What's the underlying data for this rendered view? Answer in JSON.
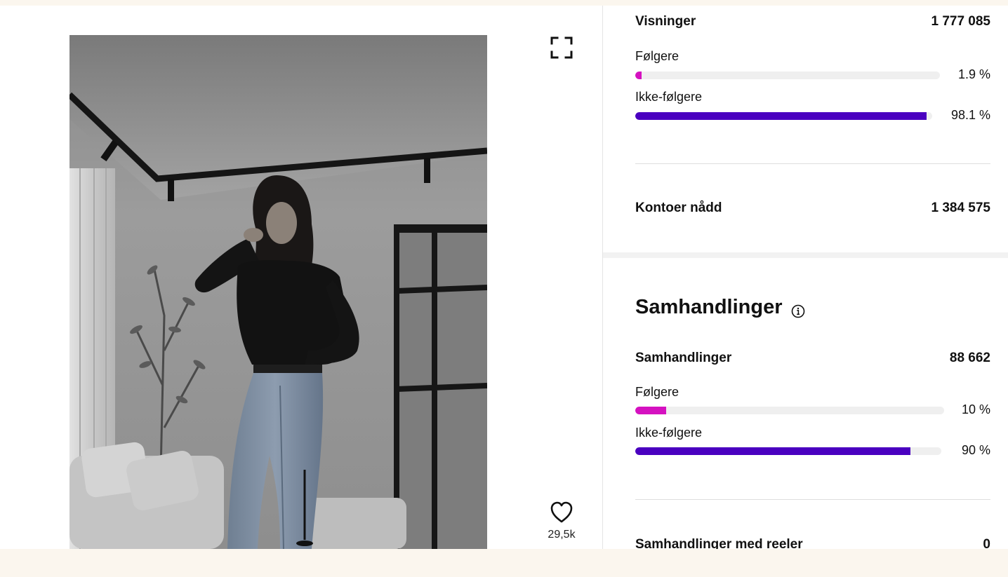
{
  "media": {
    "like_count": "29,5k"
  },
  "impressions": {
    "label": "Visninger",
    "value": "1 777 085",
    "followers": {
      "label": "Følgere",
      "percent_text": "1.9 %",
      "percent": 1.9
    },
    "non_followers": {
      "label": "Ikke-følgere",
      "percent_text": "98.1 %",
      "percent": 98.1
    }
  },
  "reach": {
    "label": "Kontoer nådd",
    "value": "1 384 575"
  },
  "interactions": {
    "title": "Samhandlinger",
    "total": {
      "label": "Samhandlinger",
      "value": "88 662"
    },
    "followers": {
      "label": "Følgere",
      "percent_text": "10 %",
      "percent": 10
    },
    "non_followers": {
      "label": "Ikke-følgere",
      "percent_text": "90 %",
      "percent": 90
    },
    "reels": {
      "label": "Samhandlinger med reeler",
      "value": "0"
    }
  },
  "colors": {
    "followers": "#d511c0",
    "non_followers": "#4a00c0",
    "track": "#efefef"
  },
  "icons": {
    "expand": "expand-icon",
    "like": "heart-icon",
    "info": "info-icon"
  }
}
